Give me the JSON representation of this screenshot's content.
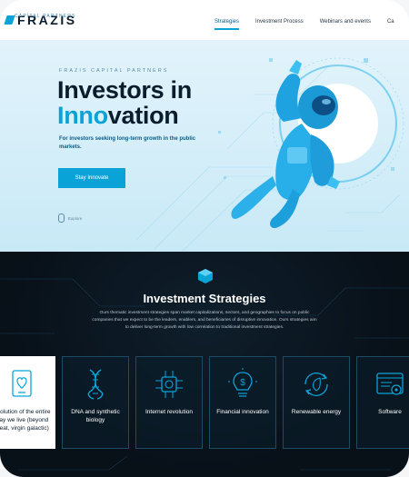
{
  "brand": {
    "name": "FRAZIS",
    "subtitle": "CAPITAL PARTNERS"
  },
  "nav": {
    "items": [
      {
        "label": "Strategies",
        "active": true
      },
      {
        "label": "Investment Process",
        "active": false
      },
      {
        "label": "Webinars and events",
        "active": false
      },
      {
        "label": "Ca",
        "active": false
      }
    ]
  },
  "hero": {
    "eyebrow": "FRAZIS CAPITAL PARTNERS",
    "headline_line1": "Investors in",
    "headline_accent": "Inno",
    "headline_rest": "vation",
    "tagline": "For investors seeking long-term growth in the public markets.",
    "cta_label": "Stay Innovate",
    "explore_label": "Explore"
  },
  "strategies": {
    "title": "Investment Strategies",
    "description": "Ours thematic investment strategies span market capitalizations, sectors, and geographies to focus on public companies that we expect to be the leaders, enablers, and beneficiaries of disruptive innovation. Ours strategies aim to deliver long-term growth with low correlation to traditional investment strategies.",
    "cards": [
      {
        "label": "Evolution of the entire way we live (beyond meat, virgin galactic)",
        "icon": "tablet-heart-icon"
      },
      {
        "label": "DNA and synthetic biology",
        "icon": "dna-icon"
      },
      {
        "label": "Internet revolution",
        "icon": "circuit-chip-icon"
      },
      {
        "label": "Financial innovation",
        "icon": "lightbulb-dollar-icon"
      },
      {
        "label": "Renewable energy",
        "icon": "leaf-cycle-icon"
      },
      {
        "label": "Software",
        "icon": "software-window-icon"
      }
    ]
  },
  "colors": {
    "accent": "#0aa3d8",
    "dark": "#0b1c2c",
    "card_border": "#1c4b66"
  }
}
